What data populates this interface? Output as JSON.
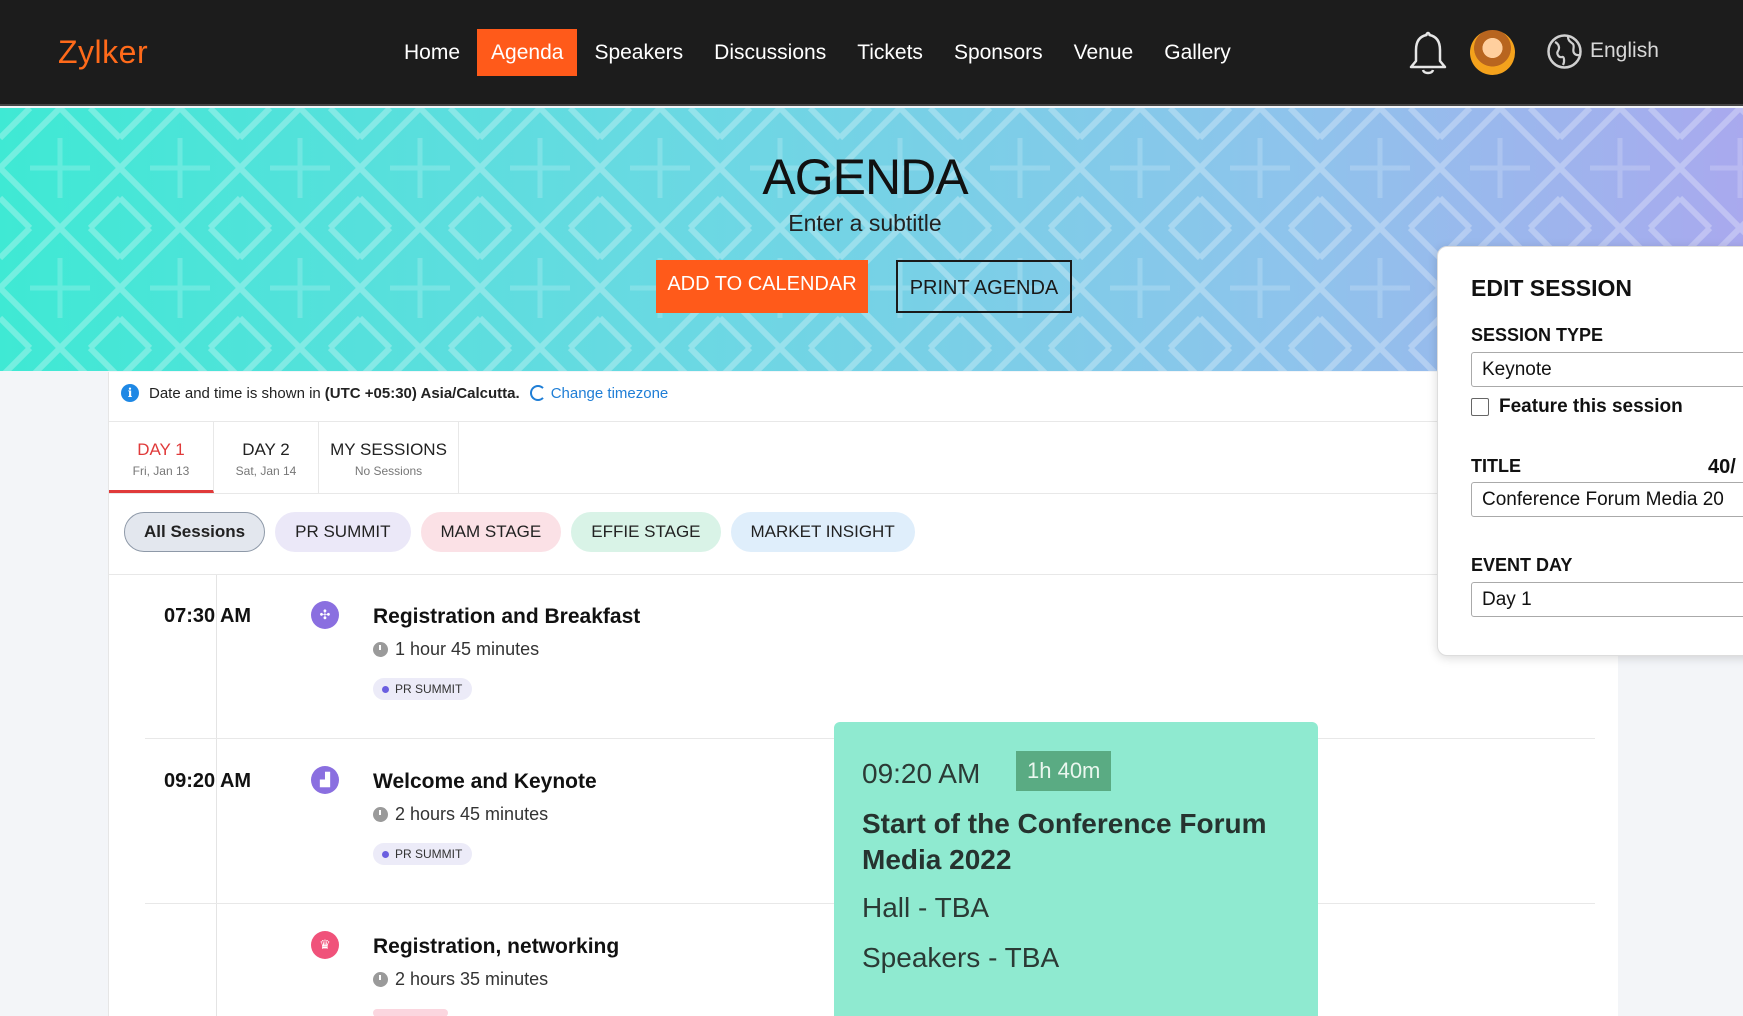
{
  "nav": {
    "logo": "Zylker",
    "items": [
      {
        "label": "Home",
        "active": false
      },
      {
        "label": "Agenda",
        "active": true
      },
      {
        "label": "Speakers",
        "active": false
      },
      {
        "label": "Discussions",
        "active": false
      },
      {
        "label": "Tickets",
        "active": false
      },
      {
        "label": "Sponsors",
        "active": false
      },
      {
        "label": "Venue",
        "active": false
      },
      {
        "label": "Gallery",
        "active": false
      }
    ],
    "language": "English",
    "icons": [
      "bell-icon",
      "avatar",
      "globe-icon"
    ]
  },
  "hero": {
    "title": "AGENDA",
    "subtitle": "Enter a subtitle",
    "add_to_calendar": "ADD TO CALENDAR",
    "print_agenda": "PRINT AGENDA"
  },
  "timezone": {
    "prefix": "Date and time is shown in",
    "zone": "(UTC +05:30) Asia/Calcutta.",
    "change": "Change timezone"
  },
  "tabs": [
    {
      "label": "DAY 1",
      "sub": "Fri, Jan 13",
      "active": true
    },
    {
      "label": "DAY 2",
      "sub": "Sat, Jan 14",
      "active": false
    },
    {
      "label": "MY SESSIONS",
      "sub": "No Sessions",
      "active": false
    }
  ],
  "filters": [
    {
      "label": "All Sessions",
      "bg": "#e3e7ee",
      "border": "#8e99a8",
      "bold": true
    },
    {
      "label": "PR SUMMIT",
      "bg": "#ebe8f8",
      "border": "#ebe8f8",
      "bold": false
    },
    {
      "label": "MAM STAGE",
      "bg": "#fbe1e6",
      "border": "#fbe1e6",
      "bold": false
    },
    {
      "label": "EFFIE STAGE",
      "bg": "#d9f3e7",
      "border": "#d9f3e7",
      "bold": false
    },
    {
      "label": "MARKET INSIGHT",
      "bg": "#dfeefb",
      "border": "#dfeefb",
      "bold": false
    }
  ],
  "sessions": [
    {
      "time": "07:30 AM",
      "title": "Registration and Breakfast",
      "duration": "1 hour 45 minutes",
      "tag": "PR SUMMIT",
      "icon": "food-icon",
      "icon_color": "#8a6fe0"
    },
    {
      "time": "09:20 AM",
      "title": "Welcome and Keynote",
      "duration": "2 hours 45 minutes",
      "tag": "PR SUMMIT",
      "icon": "podium-icon",
      "icon_color": "#8a6fe0"
    },
    {
      "time": "",
      "title": "Registration, networking",
      "duration": "2 hours 35 minutes",
      "tag": "",
      "icon": "networking-icon",
      "icon_color": "#f0527a"
    }
  ],
  "popup": {
    "time": "09:20 AM",
    "badge": "1h 40m",
    "title": "Start of the Conference Forum Media 2022",
    "hall": "Hall - TBA",
    "speakers": "Speakers - TBA"
  },
  "edit_session": {
    "heading": "EDIT SESSION",
    "session_type_label": "SESSION TYPE",
    "session_type_value": "Keynote",
    "feature_label": "Feature this session",
    "feature_checked": false,
    "title_label": "TITLE",
    "title_counter": "40/",
    "title_value": "Conference Forum Media 20",
    "event_day_label": "EVENT DAY",
    "event_day_value": "Day 1"
  }
}
